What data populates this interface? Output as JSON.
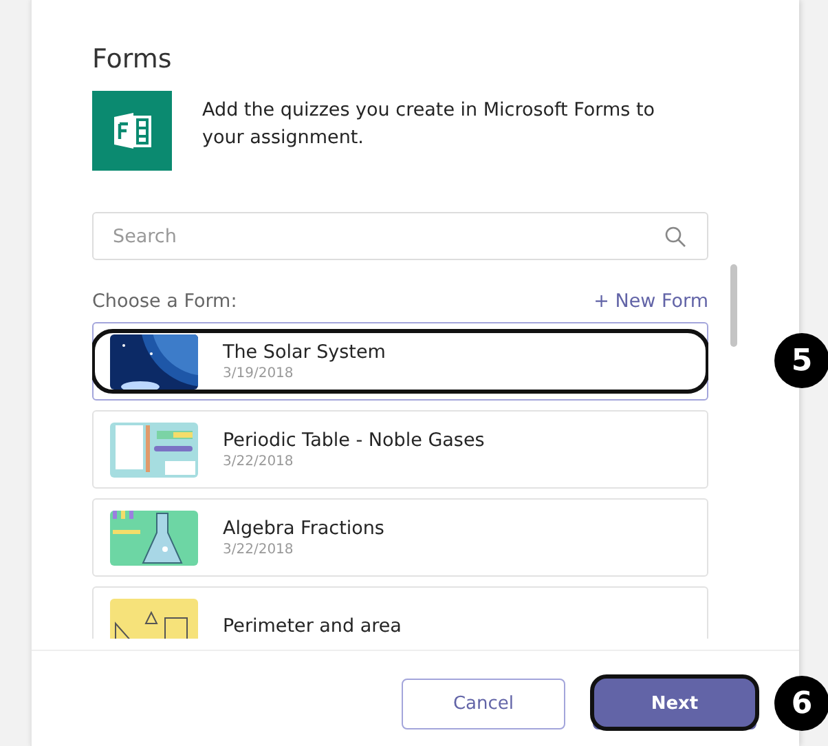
{
  "title": "Forms",
  "intro": "Add the quizzes you create in Microsoft Forms to your assignment.",
  "search": {
    "placeholder": "Search"
  },
  "list_label": "Choose a Form:",
  "new_form": "+ New Form",
  "forms": [
    {
      "name": "The Solar System",
      "date": "3/19/2018",
      "selected": true,
      "callout": "5"
    },
    {
      "name": "Periodic Table - Noble Gases",
      "date": "3/22/2018",
      "selected": false
    },
    {
      "name": "Algebra Fractions",
      "date": "3/22/2018",
      "selected": false
    },
    {
      "name": "Perimeter and area",
      "selected": false
    }
  ],
  "buttons": [
    {
      "label": "Cancel",
      "kind": "secondary"
    },
    {
      "label": "Next",
      "kind": "primary",
      "callout": "6"
    }
  ]
}
